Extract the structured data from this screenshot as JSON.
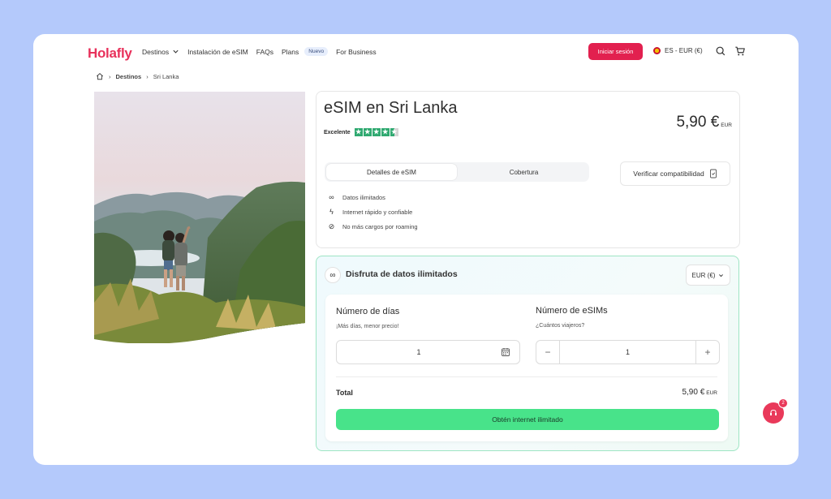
{
  "header": {
    "logo": "Holafly",
    "nav": [
      {
        "label": "Destinos"
      },
      {
        "label": "Instalación de eSIM"
      },
      {
        "label": "FAQs"
      },
      {
        "label": "Plans",
        "badge": "Nuevo"
      },
      {
        "label": "For Business"
      }
    ],
    "login_label": "Iniciar sesión",
    "language_label": "ES - EUR (€)"
  },
  "breadcrumb": {
    "items": [
      "Destinos",
      "Sri Lanka"
    ]
  },
  "product": {
    "title": "eSIM en Sri Lanka",
    "rating_label": "Excelente",
    "rating_stars": 4.5,
    "price": "5,90 €",
    "price_currency": "EUR",
    "tabs": [
      "Detalles de eSIM",
      "Cobertura"
    ],
    "active_tab": 0,
    "verify_label": "Verificar compatibilidad",
    "features": [
      {
        "icon": "infinity-icon",
        "text": "Datos ilimitados"
      },
      {
        "icon": "lightning-icon",
        "text": "Internet rápido y confiable"
      },
      {
        "icon": "no-roaming-icon",
        "text": "No más cargos por roaming"
      }
    ]
  },
  "plan": {
    "title": "Disfruta de datos ilimitados",
    "currency_select": "EUR (€)",
    "days": {
      "heading": "Número de días",
      "sub": "¡Más días, menor precio!",
      "value": "1"
    },
    "esims": {
      "heading": "Número de eSIMs",
      "sub": "¿Cuántos viajeros?",
      "value": "1"
    },
    "total_label": "Total",
    "total_value": "5,90 €",
    "total_currency": "EUR",
    "cta_label": "Obtén internet ilimitado"
  },
  "chat": {
    "badge_count": "2"
  },
  "colors": {
    "brand": "#e2204f",
    "cta": "#48e38a",
    "stars": "#2fa970",
    "background": "#b4c9fb"
  }
}
